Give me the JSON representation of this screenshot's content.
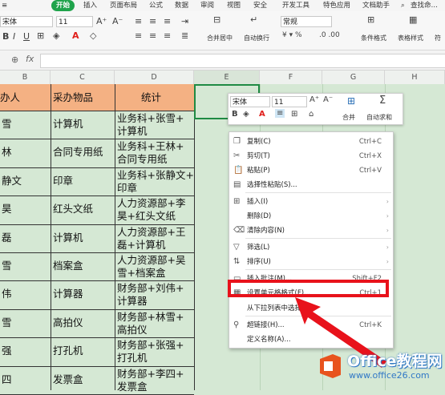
{
  "ribbon": {
    "tabs": [
      "开始",
      "插入",
      "页面布局",
      "公式",
      "数据",
      "审阅",
      "视图",
      "安全",
      "开发工具",
      "特色应用",
      "文档助手"
    ],
    "search_label": "查找命…",
    "font_name": "宋体",
    "font_size": "11",
    "number_format": "常规",
    "merge_label": "合并居中",
    "wrap_label": "自动换行",
    "cond_format_label": "条件格式",
    "table_style_label": "表格样式",
    "extra_label": "符"
  },
  "formula_bar": {
    "fx_label": "fx",
    "value": ""
  },
  "columns": [
    "B",
    "C",
    "D",
    "E",
    "F",
    "G",
    "H"
  ],
  "table": {
    "headers": [
      "办人",
      "采办物品",
      "统计"
    ],
    "rows": [
      [
        "雪",
        "计算机",
        "业务科+张雪+",
        "计算机"
      ],
      [
        "林",
        "合同专用纸",
        "业务科+王林+",
        "合同专用纸"
      ],
      [
        "静文",
        "印章",
        "业务科+张静文+",
        "印章"
      ],
      [
        "昊",
        "红头文纸",
        "人力资源部+李",
        "昊+红头文纸"
      ],
      [
        "磊",
        "计算机",
        "人力资源部+王",
        "磊+计算机"
      ],
      [
        "雪",
        "档案盒",
        "人力资源部+吴",
        "雪+档案盒"
      ],
      [
        "伟",
        "计算器",
        "财务部+刘伟+",
        "计算器"
      ],
      [
        "雪",
        "高拍仪",
        "财务部+林雪+",
        "高拍仪"
      ],
      [
        "强",
        "打孔机",
        "财务部+张强+",
        "打孔机"
      ],
      [
        "四",
        "发票盒",
        "财务部+李四+",
        "发票盒"
      ]
    ]
  },
  "mini_toolbar": {
    "font_name": "宋体",
    "font_size": "11",
    "merge_label": "合并",
    "autosum_label": "自动求和"
  },
  "context_menu": {
    "items": [
      {
        "label": "复制(C)",
        "shortcut": "Ctrl+C",
        "icon": "copy-icon"
      },
      {
        "label": "剪切(T)",
        "shortcut": "Ctrl+X",
        "icon": "cut-icon"
      },
      {
        "label": "粘贴(P)",
        "shortcut": "Ctrl+V",
        "icon": "paste-icon"
      },
      {
        "label": "选择性粘贴(S)...",
        "shortcut": "",
        "icon": "paste-special-icon"
      },
      {
        "label": "插入(I)",
        "shortcut": "",
        "icon": "insert-icon"
      },
      {
        "label": "删除(D)",
        "shortcut": "",
        "icon": ""
      },
      {
        "label": "清除内容(N)",
        "shortcut": "",
        "icon": "clear-icon"
      },
      {
        "label": "筛选(L)",
        "shortcut": "",
        "icon": "filter-icon"
      },
      {
        "label": "排序(U)",
        "shortcut": "",
        "icon": "sort-icon"
      },
      {
        "label": "插入批注(M)...",
        "shortcut": "Shift+F2",
        "icon": "comment-icon"
      },
      {
        "label": "设置单元格格式(F)...",
        "shortcut": "Ctrl+1",
        "icon": "format-cells-icon"
      },
      {
        "label": "从下拉列表中选择",
        "shortcut": "",
        "icon": ""
      },
      {
        "label": "超链接(H)...",
        "shortcut": "Ctrl+K",
        "icon": "link-icon"
      },
      {
        "label": "定义名称(A)...",
        "shortcut": "",
        "icon": ""
      }
    ]
  },
  "watermark": {
    "brand": "Office教程网",
    "url": "www.office26.com"
  },
  "colors": {
    "accent_green": "#1fa34b",
    "sheet_bg": "#d5e8d4",
    "header_fill": "#f4b183",
    "highlight_red": "#e8121b"
  }
}
